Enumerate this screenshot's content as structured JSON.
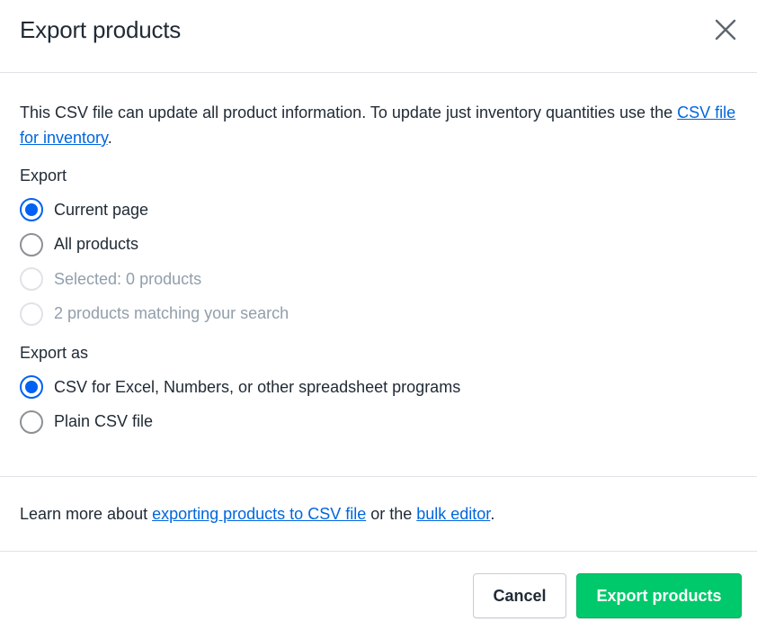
{
  "modal": {
    "title": "Export products",
    "close_icon": "close-icon"
  },
  "intro": {
    "text": "This CSV file can update all product information. To update just inventory quantities use the ",
    "link": "CSV file for inventory",
    "suffix": "."
  },
  "export": {
    "label": "Export",
    "options": [
      {
        "label": "Current page",
        "checked": true,
        "disabled": false
      },
      {
        "label": "All products",
        "checked": false,
        "disabled": false
      },
      {
        "label": "Selected: 0 products",
        "checked": false,
        "disabled": true
      },
      {
        "label": "2 products matching your search",
        "checked": false,
        "disabled": true
      }
    ]
  },
  "export_as": {
    "label": "Export as",
    "options": [
      {
        "label": "CSV for Excel, Numbers, or other spreadsheet programs",
        "checked": true,
        "disabled": false
      },
      {
        "label": "Plain CSV file",
        "checked": false,
        "disabled": false
      }
    ]
  },
  "learn_more": {
    "prefix": "Learn more about ",
    "link1": "exporting products to CSV file",
    "middle": " or the ",
    "link2": "bulk editor",
    "suffix": "."
  },
  "footer": {
    "cancel_label": "Cancel",
    "primary_label": "Export products"
  },
  "colors": {
    "accent": "#0061f2",
    "primary_button": "#00c96b",
    "link": "#0066dd"
  }
}
